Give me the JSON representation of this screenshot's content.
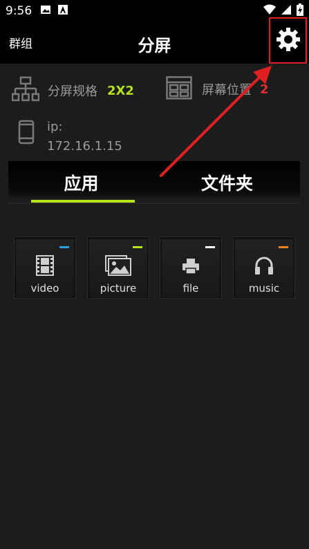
{
  "status_bar": {
    "time": "9:56",
    "left_icons": [
      "image-icon",
      "text-a-icon"
    ],
    "right_icons": [
      "wifi-icon",
      "signal-icon",
      "battery-charging-icon"
    ]
  },
  "app_bar": {
    "back_label": "群组",
    "title": "分屏",
    "settings_icon": "gear-icon"
  },
  "info": {
    "split_spec_label": "分屏规格",
    "split_spec_value": "2X2",
    "screen_position_label": "屏幕位置",
    "screen_position_value": "2",
    "ip_label": "ip:",
    "ip_value": "172.16.1.15"
  },
  "tabs": [
    {
      "label": "应用",
      "active": true
    },
    {
      "label": "文件夹",
      "active": false
    }
  ],
  "apps": [
    {
      "label": "video",
      "icon": "film-icon",
      "accent": "#2a9fe0"
    },
    {
      "label": "picture",
      "icon": "picture-icon",
      "accent": "#b6e31b"
    },
    {
      "label": "file",
      "icon": "printer-icon",
      "accent": "#ffffff"
    },
    {
      "label": "music",
      "icon": "headphones-icon",
      "accent": "#f08020"
    }
  ],
  "colors": {
    "accent_green": "#b6e31b",
    "highlight_red": "#e02020"
  }
}
